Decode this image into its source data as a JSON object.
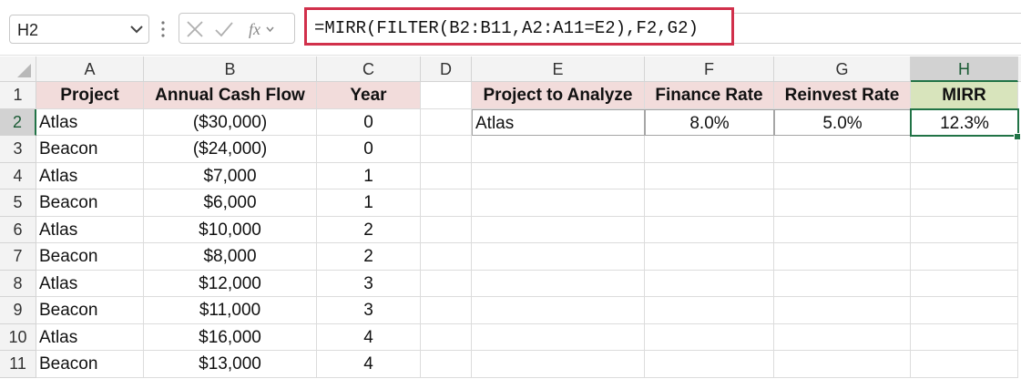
{
  "formula_bar": {
    "name_box": "H2",
    "formula": "=MIRR(FILTER(B2:B11,A2:A11=E2),F2,G2)"
  },
  "columns": [
    "A",
    "B",
    "C",
    "D",
    "E",
    "F",
    "G",
    "H"
  ],
  "rows": [
    "1",
    "2",
    "3",
    "4",
    "5",
    "6",
    "7",
    "8",
    "9",
    "10",
    "11"
  ],
  "left_table": {
    "headers": [
      "Project",
      "Annual Cash Flow",
      "Year"
    ],
    "rows": [
      [
        "Atlas",
        "($30,000)",
        "0"
      ],
      [
        "Beacon",
        "($24,000)",
        "0"
      ],
      [
        "Atlas",
        "$7,000",
        "1"
      ],
      [
        "Beacon",
        "$6,000",
        "1"
      ],
      [
        "Atlas",
        "$10,000",
        "2"
      ],
      [
        "Beacon",
        "$8,000",
        "2"
      ],
      [
        "Atlas",
        "$12,000",
        "3"
      ],
      [
        "Beacon",
        "$11,000",
        "3"
      ],
      [
        "Atlas",
        "$16,000",
        "4"
      ],
      [
        "Beacon",
        "$13,000",
        "4"
      ]
    ]
  },
  "right_table": {
    "headers": [
      "Project to Analyze",
      "Finance Rate",
      "Reinvest Rate",
      "MIRR"
    ],
    "row": [
      "Atlas",
      "8.0%",
      "5.0%",
      "12.3%"
    ]
  },
  "selected_cell": "H2",
  "colors": {
    "header_fill": "#f2dcdb",
    "result_header_fill": "#d8e4bc",
    "selection": "#217346",
    "formula_highlight": "#d1304b"
  }
}
